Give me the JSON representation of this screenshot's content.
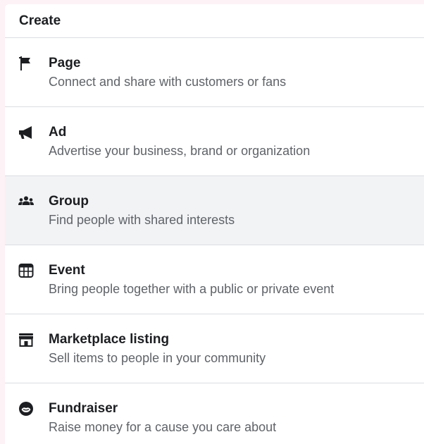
{
  "header": {
    "title": "Create"
  },
  "items": [
    {
      "title": "Page",
      "description": "Connect and share with customers or fans",
      "icon": "flag-icon"
    },
    {
      "title": "Ad",
      "description": "Advertise your business, brand or organization",
      "icon": "megaphone-icon"
    },
    {
      "title": "Group",
      "description": "Find people with shared interests",
      "icon": "group-icon"
    },
    {
      "title": "Event",
      "description": "Bring people together with a public or private event",
      "icon": "calendar-icon"
    },
    {
      "title": "Marketplace listing",
      "description": "Sell items to people in your community",
      "icon": "storefront-icon"
    },
    {
      "title": "Fundraiser",
      "description": "Raise money for a cause you care about",
      "icon": "fundraiser-icon"
    }
  ],
  "colors": {
    "text": "#1c1e21",
    "secondary": "#5f6368",
    "hover": "#f2f3f5",
    "divider": "#dadde1"
  }
}
